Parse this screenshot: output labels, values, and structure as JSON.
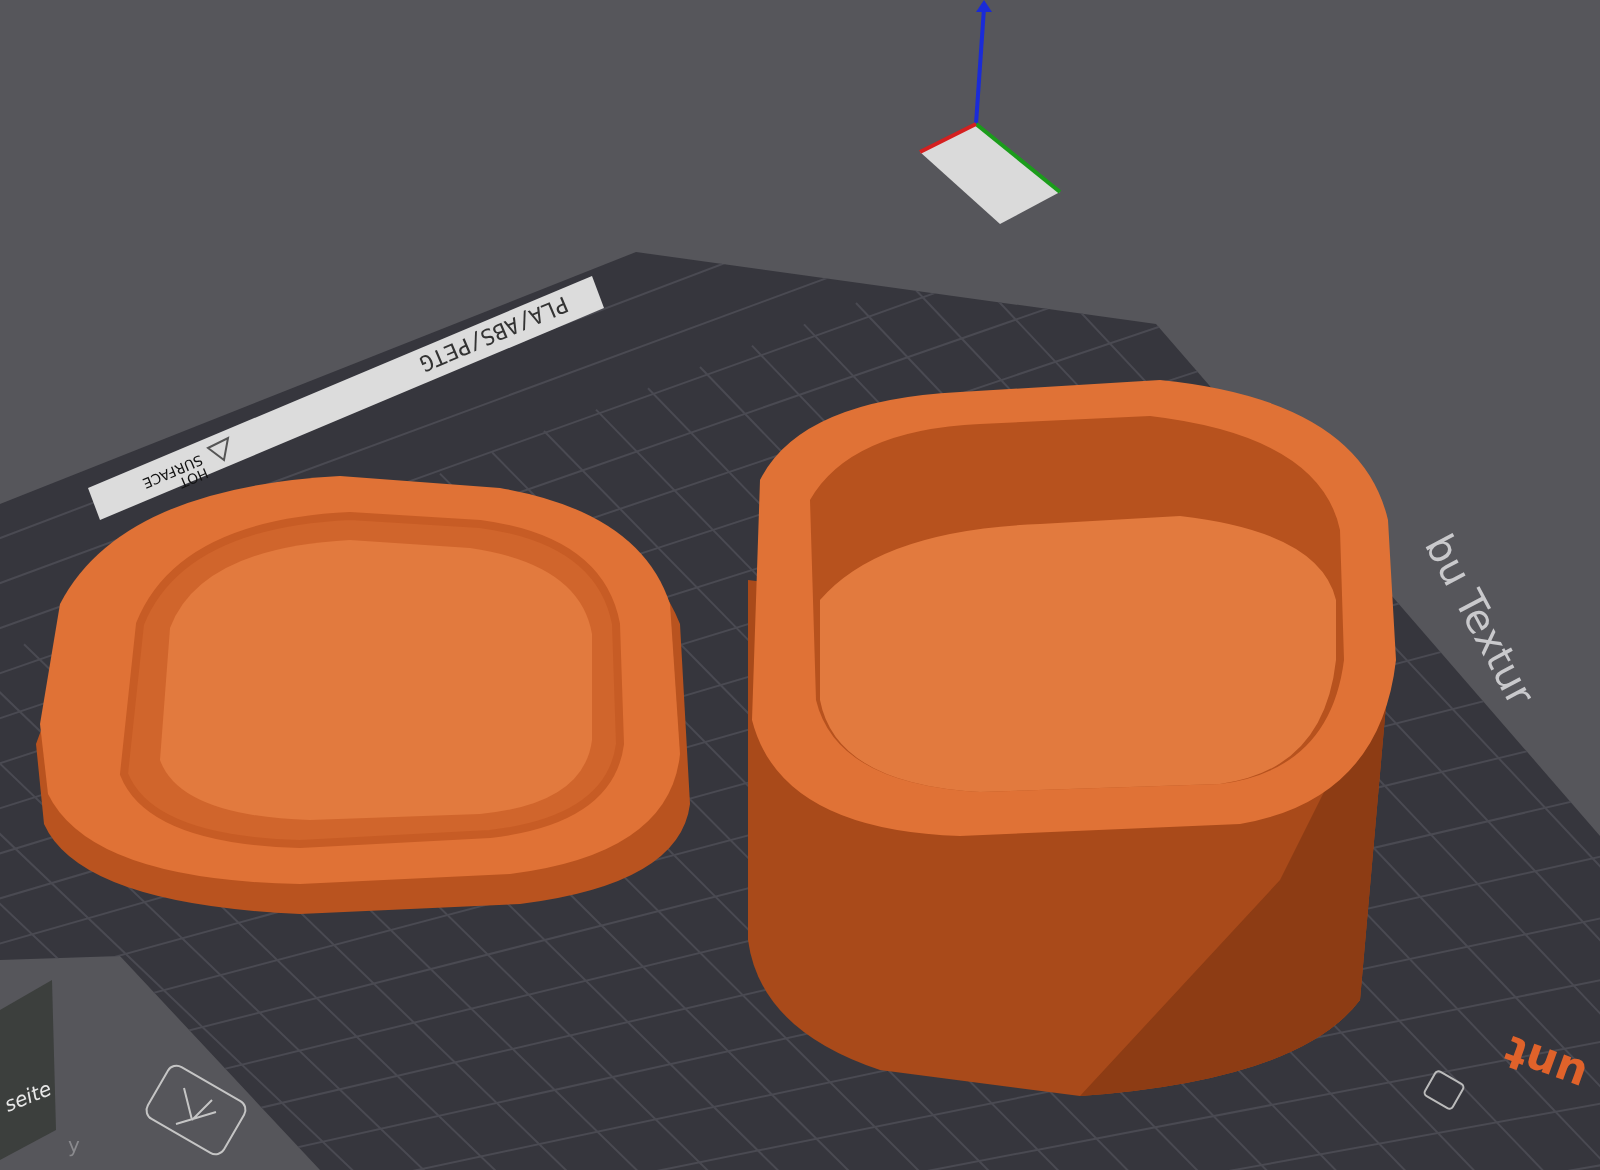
{
  "bed": {
    "material_label": "PLA/ABS/PETG",
    "warning": [
      "HOT",
      "SURFACE"
    ],
    "texture_text": "bu Textur",
    "logo_text": "unt"
  },
  "view_cube": {
    "face_label": "seite",
    "axis_label": "y"
  }
}
